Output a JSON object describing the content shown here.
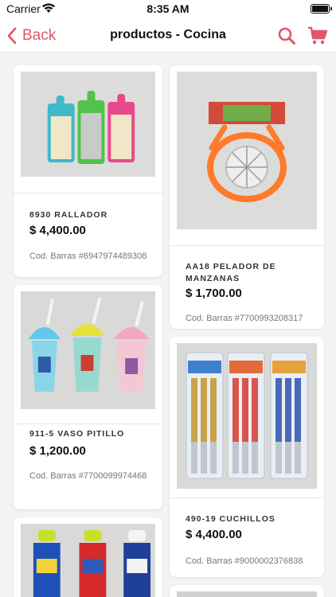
{
  "status_bar": {
    "carrier": "Carrier",
    "time": "8:35 AM"
  },
  "nav": {
    "back_label": "Back",
    "title": "productos - Cocina"
  },
  "colors": {
    "accent": "#e05569"
  },
  "products": [
    {
      "name": "8930 RALLADOR",
      "price": "$ 4,400.00",
      "code": "Cod. Barras #6947974489308"
    },
    {
      "name": "AA18 PELADOR DE MANZANAS",
      "price": "$ 1,700.00",
      "code": "Cod. Barras #7700993208317"
    },
    {
      "name": "911-5 VASO PITILLO",
      "price": "$ 1,200.00",
      "code": "Cod. Barras #7700099974468"
    },
    {
      "name": "490-19 CUCHILLOS",
      "price": "$ 4,400.00",
      "code": "Cod. Barras #9000002376838"
    }
  ],
  "icons": {
    "back": "chevron-left-icon",
    "search": "search-icon",
    "cart": "cart-icon",
    "wifi": "wifi-icon",
    "battery": "battery-icon"
  }
}
